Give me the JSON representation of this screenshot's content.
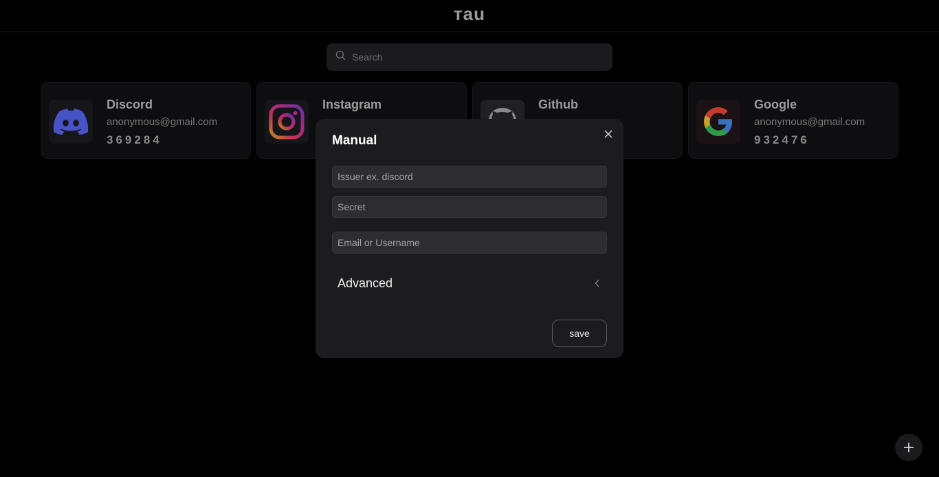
{
  "app": {
    "title": "тau"
  },
  "search": {
    "placeholder": "Search",
    "icon": "search-icon"
  },
  "accounts": [
    {
      "name": "Discord",
      "email": "anonymous@gmail.com",
      "code": "369284",
      "icon": "discord-icon"
    },
    {
      "name": "Instagram",
      "email": "",
      "code": "",
      "icon": "instagram-icon"
    },
    {
      "name": "Github",
      "email": "",
      "code": "",
      "icon": "github-icon"
    },
    {
      "name": "Google",
      "email": "anonymous@gmail.com",
      "code": "932476",
      "icon": "google-icon"
    }
  ],
  "dialog": {
    "title": "Manual",
    "close_icon": "close-icon",
    "issuer_placeholder": "Issuer ex. discord",
    "secret_placeholder": "Secret",
    "user_placeholder": "Email or Username",
    "advanced_label": "Advanced",
    "advanced_icon": "chevron-left-icon",
    "save_label": "save"
  },
  "fab": {
    "icon": "plus-icon"
  },
  "colors": {
    "background": "#000000",
    "dialog": "#1c1c1e",
    "field": "#2d2d30",
    "card": "#0e0e10",
    "discord_brand": "#5865f2"
  }
}
